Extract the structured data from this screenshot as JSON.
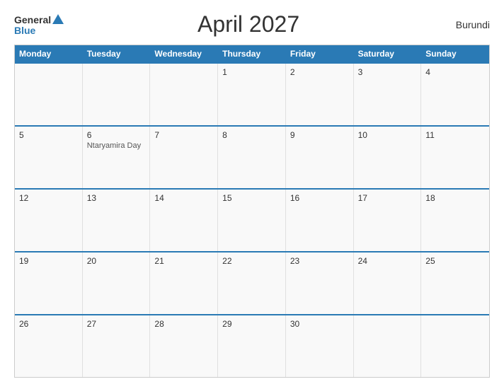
{
  "header": {
    "logo_general": "General",
    "logo_blue": "Blue",
    "title": "April 2027",
    "country": "Burundi"
  },
  "days_of_week": [
    "Monday",
    "Tuesday",
    "Wednesday",
    "Thursday",
    "Friday",
    "Saturday",
    "Sunday"
  ],
  "weeks": [
    [
      {
        "day": "",
        "empty": true
      },
      {
        "day": "",
        "empty": true
      },
      {
        "day": "",
        "empty": true
      },
      {
        "day": "1",
        "empty": false
      },
      {
        "day": "2",
        "empty": false
      },
      {
        "day": "3",
        "empty": false
      },
      {
        "day": "4",
        "empty": false
      }
    ],
    [
      {
        "day": "5",
        "empty": false
      },
      {
        "day": "6",
        "empty": false,
        "event": "Ntaryamira Day"
      },
      {
        "day": "7",
        "empty": false
      },
      {
        "day": "8",
        "empty": false
      },
      {
        "day": "9",
        "empty": false
      },
      {
        "day": "10",
        "empty": false
      },
      {
        "day": "11",
        "empty": false
      }
    ],
    [
      {
        "day": "12",
        "empty": false
      },
      {
        "day": "13",
        "empty": false
      },
      {
        "day": "14",
        "empty": false
      },
      {
        "day": "15",
        "empty": false
      },
      {
        "day": "16",
        "empty": false
      },
      {
        "day": "17",
        "empty": false
      },
      {
        "day": "18",
        "empty": false
      }
    ],
    [
      {
        "day": "19",
        "empty": false
      },
      {
        "day": "20",
        "empty": false
      },
      {
        "day": "21",
        "empty": false
      },
      {
        "day": "22",
        "empty": false
      },
      {
        "day": "23",
        "empty": false
      },
      {
        "day": "24",
        "empty": false
      },
      {
        "day": "25",
        "empty": false
      }
    ],
    [
      {
        "day": "26",
        "empty": false
      },
      {
        "day": "27",
        "empty": false
      },
      {
        "day": "28",
        "empty": false
      },
      {
        "day": "29",
        "empty": false
      },
      {
        "day": "30",
        "empty": false
      },
      {
        "day": "",
        "empty": true
      },
      {
        "day": "",
        "empty": true
      }
    ]
  ]
}
